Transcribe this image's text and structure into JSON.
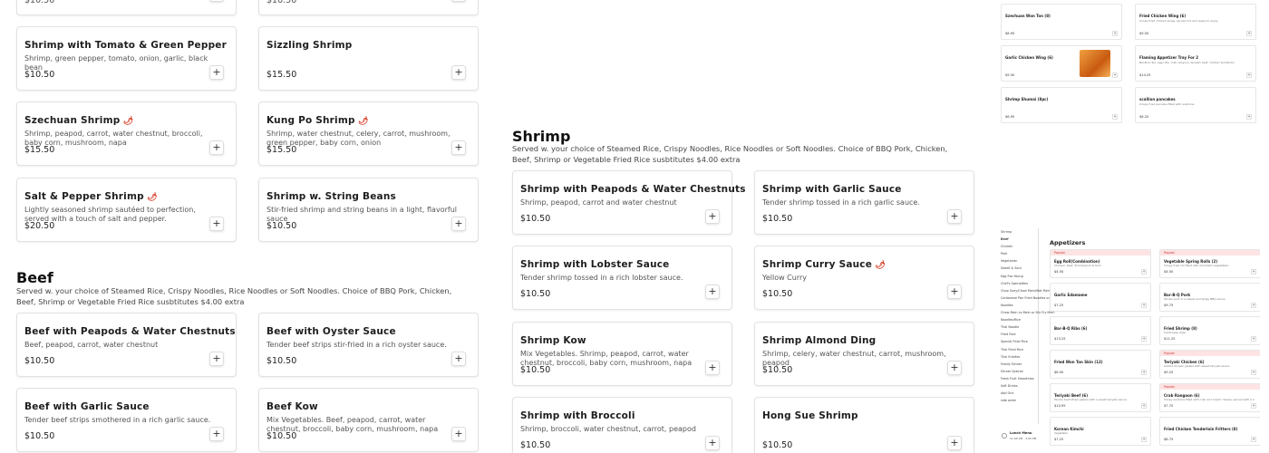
{
  "colors": {
    "accent": "#d9361f",
    "popular_bg": "#fde3e3"
  },
  "left_top_partial": {
    "prices": [
      "$10.50",
      "$10.50"
    ]
  },
  "shrimp_left_cards": [
    {
      "name": "Shrimp with Tomato & Green Pepper",
      "spicy": false,
      "desc": "Shrimp, green pepper, tomato, onion, garlic, black bean",
      "price": "$10.50"
    },
    {
      "name": "Sizzling Shrimp",
      "spicy": false,
      "desc": "",
      "price": "$15.50"
    },
    {
      "name": "Szechuan Shrimp",
      "spicy": true,
      "desc": "Shrimp, peapod, carrot, water chestnut, broccoli, baby corn, mushroom, napa",
      "price": "$15.50"
    },
    {
      "name": "Kung Po Shrimp",
      "spicy": true,
      "desc": "Shrimp, water chestnut, celery, carrot, mushroom, green pepper, baby corn, onion",
      "price": "$15.50"
    },
    {
      "name": "Salt & Pepper Shrimp",
      "spicy": true,
      "desc": "Lightly seasoned shrimp sautéed to perfection, served with a touch of salt and pepper.",
      "price": "$20.50"
    },
    {
      "name": "Shrimp w. String Beans",
      "spicy": false,
      "desc": "Stir-fried shrimp and string beans in a light, flavorful sauce",
      "price": "$10.50"
    }
  ],
  "beef_section": {
    "title": "Beef",
    "desc": "Served w. your choice of Steamed Rice, Crispy Noodles, Rice Noodles or Soft Noodles. Choice of BBQ Pork, Chicken, Beef, Shrimp or Vegetable Fried Rice susbtitutes $4.00 extra",
    "cards": [
      {
        "name": "Beef with Peapods & Water Chestnuts",
        "spicy": false,
        "desc": "Beef, peapod, carrot, water chestnut",
        "price": "$10.50"
      },
      {
        "name": "Beef with Oyster Sauce",
        "spicy": false,
        "desc": "Tender beef strips stir-fried in a rich oyster sauce.",
        "price": "$10.50"
      },
      {
        "name": "Beef with Garlic Sauce",
        "spicy": false,
        "desc": "Tender beef strips smothered in a rich garlic sauce.",
        "price": "$10.50"
      },
      {
        "name": "Beef Kow",
        "spicy": false,
        "desc": "Mix Vegetables. Beef, peapod, carrot, water chestnut, broccoli, baby corn, mushroom, napa",
        "price": "$10.50"
      }
    ]
  },
  "shrimp_section": {
    "title": "Shrimp",
    "desc": "Served w. your choice of Steamed Rice, Crispy Noodles, Rice Noodles or Soft Noodles. Choice of BBQ Pork, Chicken, Beef, Shrimp or Vegetable Fried Rice susbtitutes $4.00 extra",
    "cards": [
      {
        "name": "Shrimp with Peapods & Water Chestnuts",
        "spicy": false,
        "desc": "Shrimp, peapod, carrot and water chestnut",
        "price": "$10.50"
      },
      {
        "name": "Shrimp with Garlic Sauce",
        "spicy": false,
        "desc": "Tender shrimp tossed in a rich garlic sauce.",
        "price": "$10.50"
      },
      {
        "name": "Shrimp with Lobster Sauce",
        "spicy": false,
        "desc": "Tender shrimp tossed in a rich lobster sauce.",
        "price": "$10.50"
      },
      {
        "name": "Shrimp Curry Sauce",
        "spicy": true,
        "desc": "Yellow Curry",
        "price": "$10.50"
      },
      {
        "name": "Shrimp Kow",
        "spicy": false,
        "desc": "Mix Vegetables. Shrimp, peapod, carrot, water chestnut, broccoli, baby corn, mushroom, napa",
        "price": "$10.50"
      },
      {
        "name": "Shrimp Almond Ding",
        "spicy": false,
        "desc": "Shrimp, celery, water chestnut, carrot, mushroom, peapod",
        "price": "$10.50"
      },
      {
        "name": "Shrimp with Broccoli",
        "spicy": false,
        "desc": "Shrimp, broccoli, water chestnut, carrot, peapod",
        "price": "$10.50"
      },
      {
        "name": "Hong Sue Shrimp",
        "spicy": false,
        "desc": "",
        "price": "$10.50"
      }
    ]
  },
  "thumb_top": {
    "items": [
      {
        "name": "Szechuan Won Ton (8)",
        "desc": "",
        "price": "$8.95"
      },
      {
        "name": "Fried Chicken Wing (6)",
        "desc": "Crispy fried chicken wings, served hot and ready to enjoy.",
        "price": "$9.50"
      },
      {
        "name": "Garlic Chicken Wing (6)",
        "desc": "",
        "price": "$9.50"
      },
      {
        "name": "Flaming Appetizer Tray For 2",
        "desc": "Bar-B-Q ribs, egg rolls, crab rangoon, teriyaki beef, chicken tenderloin",
        "price": "$14.25"
      },
      {
        "name": "Shrimp Shumai (8pc)",
        "desc": "",
        "price": "$6.95"
      },
      {
        "name": "scallion pancakes",
        "desc": "Crispy fried pancake filled with scallions.",
        "price": "$6.25"
      }
    ]
  },
  "thumb_bottom": {
    "sidebar": [
      "Shrimp",
      "Beef",
      "Chicken",
      "Pork",
      "Vegetarian",
      "Sweet & Sour",
      "Egg Foo Young",
      "Chef's Specialties",
      "Chop Suey/Chow Mein/Wat Mein",
      "Cantonese Pan Fried Noodles or Lo Mein",
      "Noodles",
      "Chow Main Lo Mein or Stir Fry Mein",
      "Noodles/Rice",
      "Thai Noodle",
      "Fried Rice",
      "Special Fried Rice",
      "Thai Fried Rice",
      "Thai Entrées",
      "Family Dinner",
      "Dinner Special",
      "Fresh Fruit Smoothies",
      "Soft Drinks",
      "Add Ons",
      "side order"
    ],
    "lunch_menu": "Lunch Menu",
    "lunch_hours": "11:00 AM - 3:00 PM",
    "title": "Appetizers",
    "popular_label": "Popular",
    "items": [
      {
        "name": "Egg Roll(Combination)",
        "desc": "Chicken, beef, Shrimp/pork & ham",
        "price": "$4.50",
        "popular": true
      },
      {
        "name": "Vegetable Spring Rolls (2)",
        "desc": "Crispy fried roll filled with shredded vegetables.",
        "price": "$4.50",
        "popular": true
      },
      {
        "name": "Garlic Edamame",
        "desc": "",
        "price": "$7.25",
        "popular": false
      },
      {
        "name": "Bar-B-Q Pork",
        "desc": "Tender pork in a sweet and tangy BBQ sauce.",
        "price": "$9.75",
        "popular": false
      },
      {
        "name": "Bar-B-Q Ribs (6)",
        "desc": "",
        "price": "$13.25",
        "popular": false
      },
      {
        "name": "Fried Shrimp (8)",
        "desc": "Cantonese style",
        "price": "$11.25",
        "popular": false
      },
      {
        "name": "Fried Won Ton Skin (12)",
        "desc": "",
        "price": "$8.50",
        "popular": false
      },
      {
        "name": "Teriyaki Chicken (6)",
        "desc": "Grilled chicken glazed with sweet teriyaki sauce.",
        "price": "$9.25",
        "popular": true
      },
      {
        "name": "Teriyaki Beef (6)",
        "desc": "Tender beef strips glazed with a sweet teriyaki sauce.",
        "price": "$10.95",
        "popular": false
      },
      {
        "name": "Crab Rangoon (6)",
        "desc": "Crispy wontons filled with crab and cream cheese, served with a sweet chili sauce.",
        "price": "$7.75",
        "popular": true
      },
      {
        "name": "Korean Kimchi",
        "desc": "Vegetable",
        "price": "$7.25",
        "popular": false
      },
      {
        "name": "Fried Chicken Tenderloin Fritters (8)",
        "desc": "",
        "price": "$8.75",
        "popular": false
      }
    ]
  }
}
